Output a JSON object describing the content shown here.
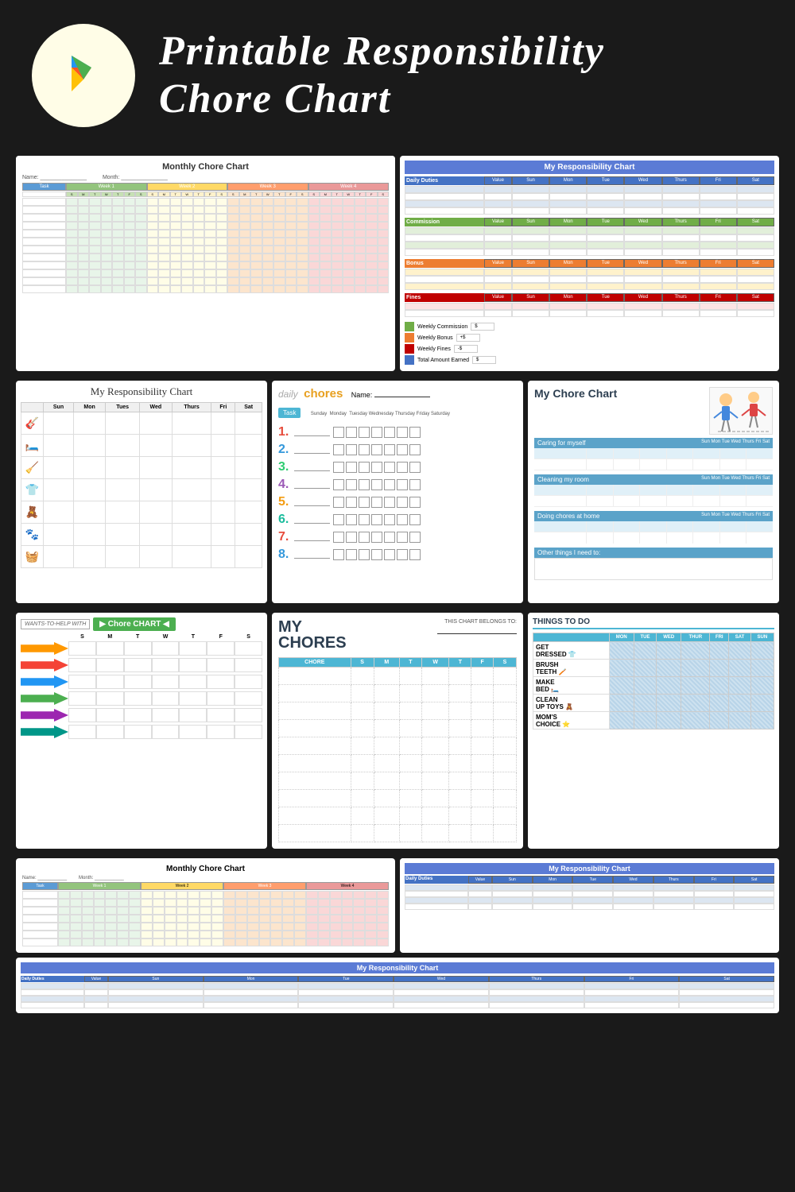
{
  "header": {
    "title_line1": "Printable Responsibility",
    "title_line2": "Chore Chart"
  },
  "cards": {
    "monthly_chart": {
      "title": "Monthly Chore Chart",
      "sub_labels": [
        "Name:",
        "Month:"
      ],
      "col_labels": [
        "Task",
        "Week 1",
        "Week 2",
        "Week 3",
        "Week 4"
      ]
    },
    "responsibility_chart_top": {
      "title": "My Responsibility Chart",
      "sections": [
        "Daily Duties",
        "Commission",
        "Bonus",
        "Fines"
      ],
      "days": [
        "Value",
        "Sun",
        "Mon",
        "Tue",
        "Wed",
        "Thurs",
        "Fri",
        "Sat"
      ],
      "summary_labels": [
        "Weekly Commission",
        "Weekly Bonus",
        "Weekly Fines",
        "Total Amount Earned"
      ],
      "summary_values": [
        "$",
        "$",
        "-$",
        "$"
      ]
    },
    "my_responsibility_left": {
      "title": "My Responsibility Chart",
      "days": [
        "Sun",
        "Mon",
        "Tues",
        "Wed",
        "Thurs",
        "Fri",
        "Sat"
      ],
      "icons": [
        "🎸",
        "🛏️",
        "🧹",
        "👕",
        "🧸",
        "🐾",
        "🧺"
      ]
    },
    "daily_chores": {
      "header_daily": "daily",
      "header_chores": "chores",
      "name_label": "Name:",
      "task_label": "Task",
      "days": [
        "Sunday",
        "Monday",
        "Tuesday",
        "Wednesday",
        "Thursday",
        "Friday",
        "Saturday"
      ],
      "items": [
        "1.",
        "2.",
        "3.",
        "4.",
        "5.",
        "6.",
        "7.",
        "8."
      ]
    },
    "my_chore_chart": {
      "title": "My Chore Chart",
      "sections": [
        "Caring for myself",
        "Cleaning my room",
        "Doing chores at home",
        "Other things I need to:"
      ],
      "days": [
        "Sun",
        "Mon",
        "Tue",
        "Wed",
        "Thurs",
        "Fri",
        "Sat"
      ]
    },
    "wants_chore_chart": {
      "wants_label": "WANTS-TO-HELP WITH",
      "banner": "Chore CHART",
      "days": [
        "S",
        "M",
        "T",
        "W",
        "T",
        "F",
        "S"
      ],
      "rows": 6
    },
    "my_chores_mid": {
      "title": "MY\nCHORES",
      "belongs_label": "THIS CHART BELONGS TO:",
      "col_headers": [
        "CHORE",
        "S",
        "M",
        "T",
        "W",
        "T",
        "F",
        "S"
      ],
      "rows": 10
    },
    "things_todo": {
      "title": "THINGS\nTO DO",
      "days": [
        "MON",
        "TUE",
        "WED",
        "THUR",
        "FRI",
        "SAT",
        "SUN"
      ],
      "items": [
        {
          "label": "GET\nDRESSED",
          "icon": "👕"
        },
        {
          "label": "BRUSH\nTEETH",
          "icon": "🪥"
        },
        {
          "label": "MAKE\nBED",
          "icon": "🛏️"
        },
        {
          "label": "CLEAN\nUP TOYS",
          "icon": "🧸"
        },
        {
          "label": "MOM'S\nCHOICE",
          "icon": "⭐"
        }
      ]
    },
    "monthly_chart_bottom": {
      "title": "Monthly Chore Chart"
    },
    "responsibility_chart_bottom": {
      "title": "My Responsibility Chart",
      "sections": [
        "Daily Duties"
      ],
      "days": [
        "Value",
        "Sun",
        "Mon",
        "Tue",
        "Wed",
        "Thurs",
        "Fri",
        "Sat"
      ]
    },
    "my_responsibility_bottom": {
      "title": "My Responsibility Chart"
    }
  }
}
